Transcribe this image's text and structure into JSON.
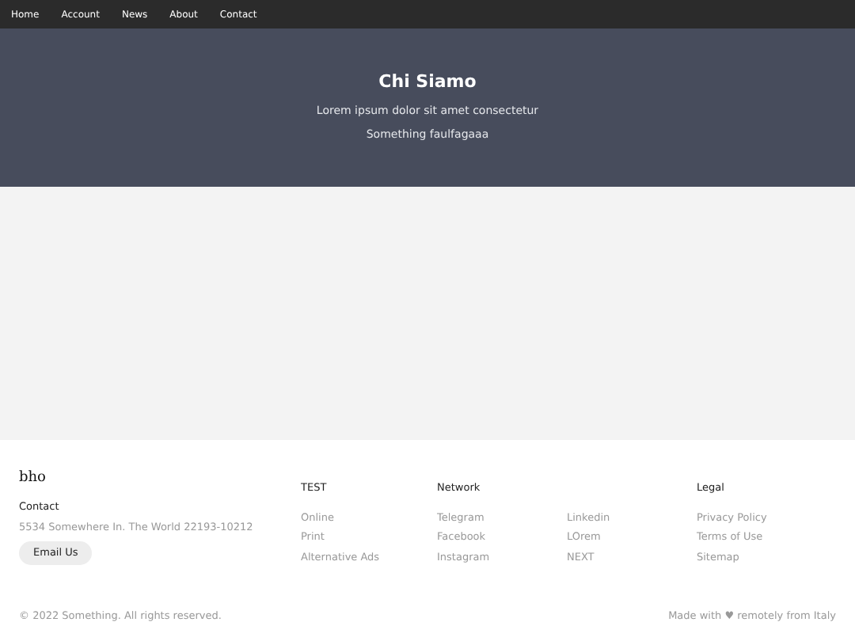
{
  "nav": [
    "Home",
    "Account",
    "News",
    "About",
    "Contact"
  ],
  "hero": {
    "title": "Chi Siamo",
    "lines": [
      "Lorem ipsum dolor sit amet consectetur",
      "Something faulfagaaa"
    ]
  },
  "footer": {
    "brand": "bho",
    "contact_heading": "Contact",
    "address": "5534 Somewhere In. The World 22193-10212",
    "email_button": "Email Us",
    "columns": [
      {
        "heading": "TEST",
        "links": [
          "Online",
          "Print",
          "Alternative Ads"
        ]
      },
      {
        "heading": "Network",
        "links": [
          "Telegram",
          "Facebook",
          "Instagram"
        ]
      },
      {
        "links": [
          "Linkedin",
          "LOrem",
          "NEXT"
        ]
      },
      {
        "heading": "Legal",
        "links": [
          "Privacy Policy",
          "Terms of Use",
          "Sitemap"
        ]
      }
    ],
    "copyright": "© 2022 Something. All rights reserved.",
    "made_with": "Made with ♥ remotely from Italy"
  }
}
